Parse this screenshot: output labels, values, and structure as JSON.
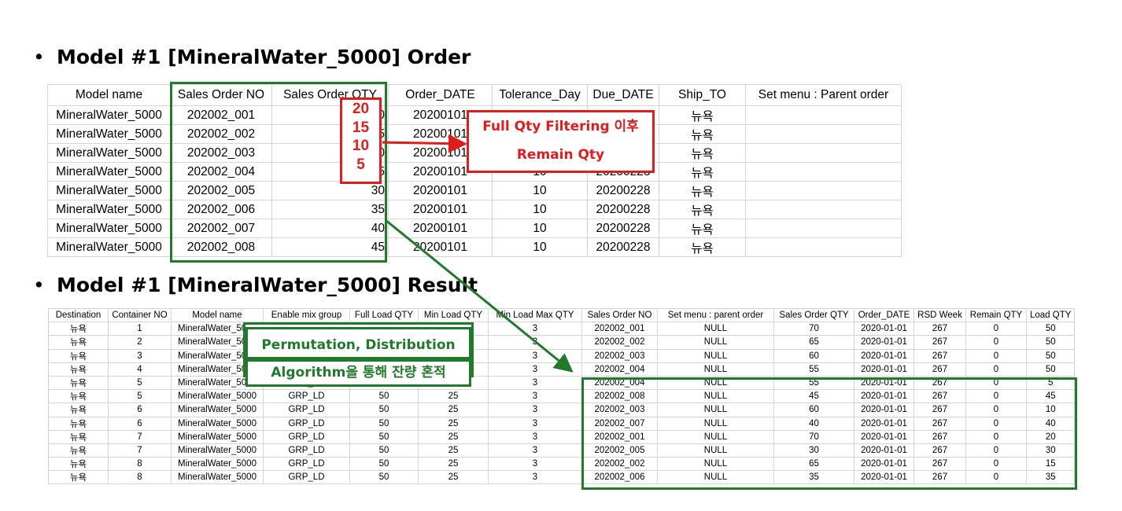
{
  "heading1": "Model #1 [MineralWater_5000] Order",
  "heading2": "Model #1 [MineralWater_5000] Result",
  "orders": {
    "columns": [
      "Model name",
      "Sales Order NO",
      "Sales Order QTY",
      "Order_DATE",
      "Tolerance_Day",
      "Due_DATE",
      "Ship_TO",
      "Set menu : Parent order"
    ],
    "rows": [
      [
        "MineralWater_5000",
        "202002_001",
        "70",
        "20200101",
        "10",
        "20200228",
        "뉴욕",
        ""
      ],
      [
        "MineralWater_5000",
        "202002_002",
        "65",
        "20200101",
        "10",
        "20200228",
        "뉴욕",
        ""
      ],
      [
        "MineralWater_5000",
        "202002_003",
        "60",
        "20200101",
        "10",
        "20200228",
        "뉴욕",
        ""
      ],
      [
        "MineralWater_5000",
        "202002_004",
        "55",
        "20200101",
        "10",
        "20200228",
        "뉴욕",
        ""
      ],
      [
        "MineralWater_5000",
        "202002_005",
        "30",
        "20200101",
        "10",
        "20200228",
        "뉴욕",
        ""
      ],
      [
        "MineralWater_5000",
        "202002_006",
        "35",
        "20200101",
        "10",
        "20200228",
        "뉴욕",
        ""
      ],
      [
        "MineralWater_5000",
        "202002_007",
        "40",
        "20200101",
        "10",
        "20200228",
        "뉴욕",
        ""
      ],
      [
        "MineralWater_5000",
        "202002_008",
        "45",
        "20200101",
        "10",
        "20200228",
        "뉴욕",
        ""
      ]
    ]
  },
  "remain_values": [
    "20",
    "15",
    "10",
    "5"
  ],
  "callout_red": {
    "line1": "Full Qty Filtering 이후",
    "line2": "Remain Qty"
  },
  "callout_green": {
    "line1": "Permutation, Distribution",
    "line2": "Algorithm을 통해 잔량 혼적"
  },
  "results": {
    "columns": [
      "Destination",
      "Container NO",
      "Model name",
      "Enable mix group",
      "Full Load QTY",
      "Min Load QTY",
      "Min Load Max QTY",
      "Sales Order NO",
      "Set menu : parent order",
      "Sales Order QTY",
      "Order_DATE",
      "RSD Week",
      "Remain QTY",
      "Load QTY"
    ],
    "rows": [
      [
        "뉴욕",
        "1",
        "MineralWater_5000",
        "GRP_LD",
        "50",
        "25",
        "3",
        "202002_001",
        "NULL",
        "70",
        "2020-01-01",
        "267",
        "0",
        "50"
      ],
      [
        "뉴욕",
        "2",
        "MineralWater_5000",
        "GRP_LD",
        "50",
        "25",
        "3",
        "202002_002",
        "NULL",
        "65",
        "2020-01-01",
        "267",
        "0",
        "50"
      ],
      [
        "뉴욕",
        "3",
        "MineralWater_5000",
        "GRP_LD",
        "50",
        "25",
        "3",
        "202002_003",
        "NULL",
        "60",
        "2020-01-01",
        "267",
        "0",
        "50"
      ],
      [
        "뉴욕",
        "4",
        "MineralWater_5000",
        "GRP_LD",
        "50",
        "25",
        "3",
        "202002_004",
        "NULL",
        "55",
        "2020-01-01",
        "267",
        "0",
        "50"
      ],
      [
        "뉴욕",
        "5",
        "MineralWater_5000",
        "GRP_LD",
        "50",
        "25",
        "3",
        "202002_004",
        "NULL",
        "55",
        "2020-01-01",
        "267",
        "0",
        "5"
      ],
      [
        "뉴욕",
        "5",
        "MineralWater_5000",
        "GRP_LD",
        "50",
        "25",
        "3",
        "202002_008",
        "NULL",
        "45",
        "2020-01-01",
        "267",
        "0",
        "45"
      ],
      [
        "뉴욕",
        "6",
        "MineralWater_5000",
        "GRP_LD",
        "50",
        "25",
        "3",
        "202002_003",
        "NULL",
        "60",
        "2020-01-01",
        "267",
        "0",
        "10"
      ],
      [
        "뉴욕",
        "6",
        "MineralWater_5000",
        "GRP_LD",
        "50",
        "25",
        "3",
        "202002_007",
        "NULL",
        "40",
        "2020-01-01",
        "267",
        "0",
        "40"
      ],
      [
        "뉴욕",
        "7",
        "MineralWater_5000",
        "GRP_LD",
        "50",
        "25",
        "3",
        "202002_001",
        "NULL",
        "70",
        "2020-01-01",
        "267",
        "0",
        "20"
      ],
      [
        "뉴욕",
        "7",
        "MineralWater_5000",
        "GRP_LD",
        "50",
        "25",
        "3",
        "202002_005",
        "NULL",
        "30",
        "2020-01-01",
        "267",
        "0",
        "30"
      ],
      [
        "뉴욕",
        "8",
        "MineralWater_5000",
        "GRP_LD",
        "50",
        "25",
        "3",
        "202002_002",
        "NULL",
        "65",
        "2020-01-01",
        "267",
        "0",
        "15"
      ],
      [
        "뉴욕",
        "8",
        "MineralWater_5000",
        "GRP_LD",
        "50",
        "25",
        "3",
        "202002_006",
        "NULL",
        "35",
        "2020-01-01",
        "267",
        "0",
        "35"
      ]
    ]
  },
  "colors": {
    "highlight_green": "#217a2b",
    "highlight_red": "#e01c1c",
    "grid": "#d4d4d4"
  }
}
